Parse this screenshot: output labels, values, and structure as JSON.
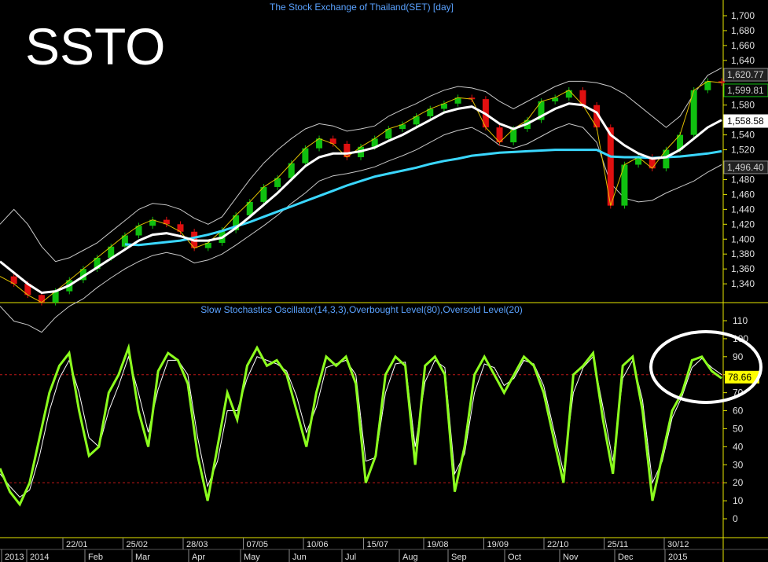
{
  "symbol": "SSTO",
  "colors": {
    "background": "#000000",
    "axis": "#e6e600",
    "price_up": "#10c010",
    "price_down": "#e01010",
    "sma_long": "#3ad7ff",
    "sma_mid": "#ffffff",
    "bollinger": "#c8c8c8",
    "stoch_k": "#8cff1e",
    "stoch_d": "#ffffff",
    "overbought": "#c01818",
    "oversold": "#c01818",
    "title_text": "#5aa2ff",
    "highlight_circle": "#ffffff"
  },
  "chart_data": [
    {
      "type": "line",
      "title": "The Stock Exchange of Thailand(SET) [day]",
      "ylim": [
        1320,
        1710
      ],
      "y_ticks": [
        "1,700",
        "1,680",
        "1,660",
        "1,640",
        "1,620",
        "1,600",
        "1,580",
        "1,560",
        "1,540",
        "1,520",
        "1,500",
        "1,480",
        "1,460",
        "1,440",
        "1,420",
        "1,400",
        "1,380",
        "1,360",
        "1,340"
      ],
      "series": [
        {
          "key": "price",
          "values": [
            1350,
            1340,
            1325,
            1315,
            1330,
            1345,
            1360,
            1375,
            1390,
            1405,
            1418,
            1426,
            1420,
            1410,
            1388,
            1395,
            1412,
            1432,
            1450,
            1470,
            1482,
            1502,
            1522,
            1535,
            1528,
            1510,
            1524,
            1535,
            1548,
            1554,
            1565,
            1575,
            1582,
            1590,
            1588,
            1550,
            1530,
            1548,
            1560,
            1585,
            1590,
            1600,
            1580,
            1550,
            1445,
            1500,
            1510,
            1495,
            1520,
            1540,
            1600,
            1612,
            1610
          ]
        },
        {
          "key": "sma_long",
          "values": [
            null,
            null,
            null,
            null,
            null,
            null,
            null,
            null,
            null,
            1393,
            1392,
            1394,
            1396,
            1398,
            1402,
            1406,
            1411,
            1417,
            1423,
            1430,
            1437,
            1444,
            1451,
            1458,
            1465,
            1472,
            1478,
            1484,
            1488,
            1492,
            1496,
            1501,
            1505,
            1508,
            1512,
            1514,
            1516,
            1517,
            1518,
            1519,
            1520,
            1520,
            1520,
            1520,
            1511,
            1510,
            1510,
            1509,
            1510,
            1511,
            1513,
            1515,
            1518
          ]
        },
        {
          "key": "sma_mid",
          "values": [
            1370,
            1355,
            1340,
            1328,
            1330,
            1338,
            1350,
            1362,
            1374,
            1386,
            1398,
            1406,
            1408,
            1404,
            1398,
            1398,
            1402,
            1415,
            1430,
            1446,
            1462,
            1480,
            1498,
            1510,
            1515,
            1515,
            1518,
            1523,
            1532,
            1540,
            1550,
            1560,
            1570,
            1575,
            1578,
            1568,
            1555,
            1548,
            1555,
            1565,
            1575,
            1582,
            1580,
            1570,
            1540,
            1526,
            1515,
            1508,
            1510,
            1520,
            1535,
            1550,
            1560
          ]
        },
        {
          "key": "bb_upper",
          "values": [
            1420,
            1440,
            1420,
            1390,
            1370,
            1375,
            1385,
            1395,
            1410,
            1425,
            1440,
            1448,
            1446,
            1440,
            1428,
            1420,
            1430,
            1455,
            1480,
            1502,
            1520,
            1535,
            1548,
            1555,
            1552,
            1545,
            1548,
            1552,
            1565,
            1574,
            1582,
            1592,
            1600,
            1605,
            1603,
            1598,
            1585,
            1575,
            1585,
            1595,
            1605,
            1612,
            1612,
            1610,
            1605,
            1595,
            1580,
            1565,
            1550,
            1565,
            1595,
            1620,
            1630
          ]
        },
        {
          "key": "bb_lower",
          "values": [
            1310,
            1290,
            1285,
            1275,
            1295,
            1310,
            1320,
            1335,
            1348,
            1360,
            1370,
            1378,
            1382,
            1378,
            1368,
            1372,
            1380,
            1392,
            1405,
            1418,
            1432,
            1448,
            1462,
            1478,
            1485,
            1488,
            1492,
            1497,
            1505,
            1512,
            1520,
            1530,
            1540,
            1546,
            1550,
            1540,
            1526,
            1522,
            1528,
            1538,
            1548,
            1555,
            1550,
            1530,
            1475,
            1455,
            1450,
            1452,
            1462,
            1470,
            1478,
            1490,
            1500
          ]
        }
      ],
      "price_labels": [
        {
          "text": "1,620.77",
          "value": 1620.77,
          "box": "#222222",
          "fg": "#d0d0d0",
          "border": "#888888"
        },
        {
          "text": "1,599.81",
          "value": 1599.81,
          "box": "#0a0a0a",
          "fg": "#d0d0d0",
          "border": "#10c010"
        },
        {
          "text": "1,558.58",
          "value": 1558.58,
          "box": "#ffffff",
          "fg": "#000000",
          "border": "#ffffff"
        },
        {
          "text": "1,496.40",
          "value": 1496.4,
          "box": "#222222",
          "fg": "#d0d0d0",
          "border": "#888888"
        }
      ]
    },
    {
      "type": "line",
      "title": "Slow Stochastics Oscillator(14,3,3),Overbought Level(80),Oversold Level(20)",
      "ylim": [
        -10,
        115
      ],
      "y_ticks": [
        "110",
        "100",
        "90",
        "80",
        "70",
        "60",
        "50",
        "40",
        "30",
        "20",
        "10",
        "0"
      ],
      "overbought": 80,
      "oversold": 20,
      "series": [
        {
          "key": "k",
          "values": [
            28,
            15,
            8,
            20,
            45,
            70,
            85,
            92,
            60,
            35,
            40,
            70,
            80,
            95,
            60,
            40,
            82,
            92,
            88,
            75,
            35,
            10,
            40,
            70,
            55,
            85,
            95,
            85,
            88,
            80,
            60,
            40,
            70,
            90,
            85,
            90,
            75,
            20,
            35,
            80,
            90,
            85,
            30,
            85,
            90,
            80,
            15,
            40,
            80,
            90,
            80,
            70,
            80,
            90,
            85,
            70,
            45,
            20,
            80,
            85,
            92,
            55,
            25,
            85,
            90,
            60,
            10,
            35,
            60,
            70,
            88,
            90,
            82,
            78
          ]
        },
        {
          "key": "d",
          "values": [
            25,
            18,
            12,
            16,
            35,
            60,
            78,
            88,
            70,
            45,
            40,
            60,
            74,
            90,
            70,
            48,
            72,
            88,
            88,
            80,
            45,
            18,
            32,
            60,
            60,
            78,
            90,
            88,
            86,
            82,
            68,
            48,
            62,
            84,
            86,
            88,
            80,
            32,
            34,
            70,
            86,
            87,
            40,
            76,
            88,
            84,
            25,
            36,
            70,
            86,
            84,
            74,
            78,
            88,
            86,
            74,
            50,
            26,
            70,
            84,
            90,
            62,
            32,
            78,
            88,
            66,
            20,
            32,
            56,
            68,
            84,
            89,
            84,
            80
          ]
        }
      ],
      "value_label": {
        "text": "78.66",
        "value": 78.66,
        "box": "#ffff00",
        "fg": "#000000"
      },
      "highlight_circle": true
    }
  ],
  "x_axis": {
    "upper_labels": [
      "22/01",
      "25/02",
      "28/03",
      "07/05",
      "10/06",
      "15/07",
      "19/08",
      "19/09",
      "22/10",
      "25/11",
      "30/12"
    ],
    "lower_labels": [
      "2013",
      "2014",
      "Feb",
      "Mar",
      "Apr",
      "May",
      "Jun",
      "Jul",
      "Aug",
      "Sep",
      "Oct",
      "Nov",
      "Dec",
      "2015"
    ]
  }
}
